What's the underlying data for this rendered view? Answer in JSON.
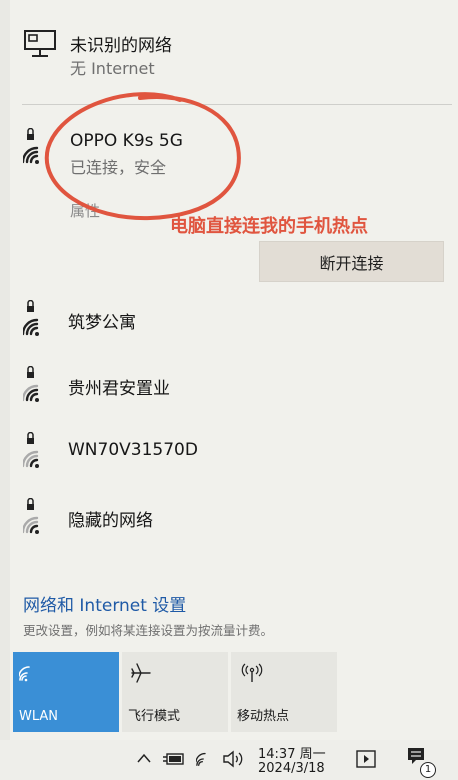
{
  "networks": {
    "unknown": {
      "name": "未识别的网络",
      "status": "无 Internet"
    },
    "connected": {
      "name": "OPPO K9s 5G",
      "status": "已连接，安全",
      "properties_label": "属性",
      "disconnect_label": "断开连接"
    },
    "list": [
      {
        "name": "筑梦公寓"
      },
      {
        "name": "贵州君安置业"
      },
      {
        "name": "WN70V31570D"
      },
      {
        "name": "隐藏的网络"
      }
    ]
  },
  "annotation": {
    "text": "电脑直接连我的手机热点",
    "color": "#e0553f"
  },
  "settings": {
    "link": "网络和 Internet 设置",
    "hint": "更改设置，例如将某连接设置为按流量计费。"
  },
  "quick_actions": [
    {
      "label": "WLAN",
      "icon": "wifi-icon",
      "active": true
    },
    {
      "label": "飞行模式",
      "icon": "airplane-icon",
      "active": false
    },
    {
      "label": "移动热点",
      "icon": "hotspot-icon",
      "active": false
    }
  ],
  "taskbar": {
    "time": "14:37 周一",
    "date": "2024/3/18",
    "notification_count": "1"
  },
  "colors": {
    "accent": "#3a8fd6",
    "link": "#1f5aa6",
    "panel": "#f1f1ec"
  }
}
